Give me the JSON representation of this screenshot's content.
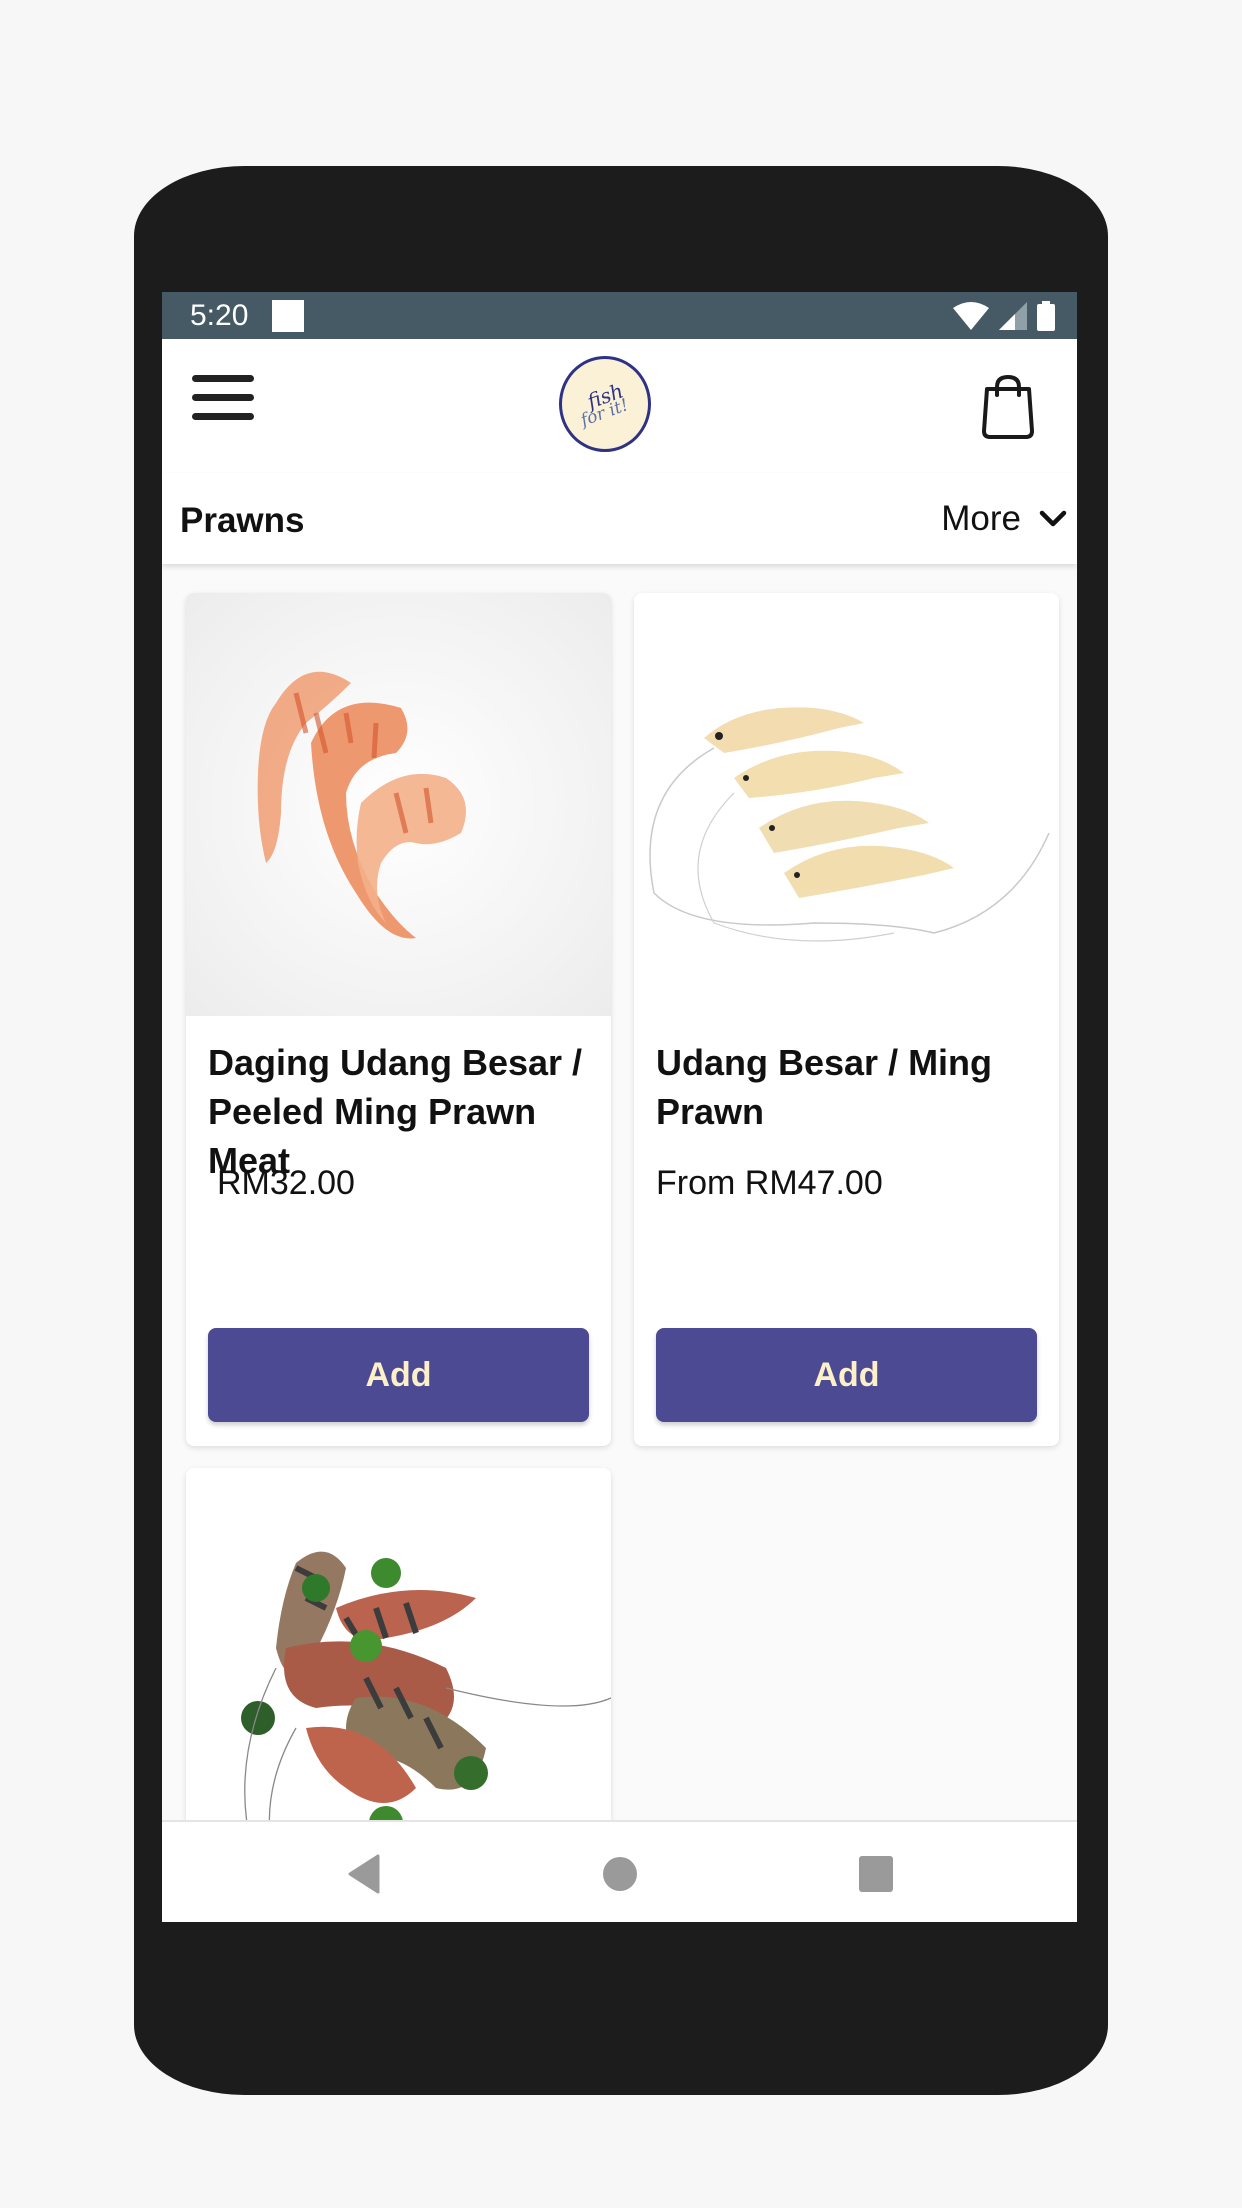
{
  "status_bar": {
    "time": "5:20",
    "icons": [
      "notification-icon",
      "wifi-icon",
      "signal-icon",
      "battery-icon"
    ]
  },
  "header": {
    "menu_icon": "hamburger-menu-icon",
    "logo": {
      "line1": "fish",
      "line2": "for it!"
    },
    "cart_icon": "shopping-bag-icon"
  },
  "category_bar": {
    "title": "Prawns",
    "more_label": "More",
    "more_icon": "chevron-down-icon"
  },
  "products": [
    {
      "title": "Daging Udang Besar / Peeled Ming Prawn Meat",
      "price": "RM32.00",
      "button_label": "Add",
      "image": "peeled-prawns-image"
    },
    {
      "title": "Udang Besar / Ming Prawn",
      "price": "From RM47.00",
      "button_label": "Add",
      "image": "ming-prawns-image"
    },
    {
      "title": "",
      "price": "",
      "button_label": "",
      "image": "tiger-prawns-with-limes-image"
    }
  ],
  "nav_bar": {
    "buttons": [
      "back-icon",
      "home-icon",
      "recents-icon"
    ]
  },
  "colors": {
    "status_bar": "#455a64",
    "accent_button": "#4b4a93",
    "button_text": "#fbf0c8",
    "logo_cream": "#fbf1d6",
    "logo_navy": "#2e3284",
    "device_frame": "#1c1c1c"
  }
}
